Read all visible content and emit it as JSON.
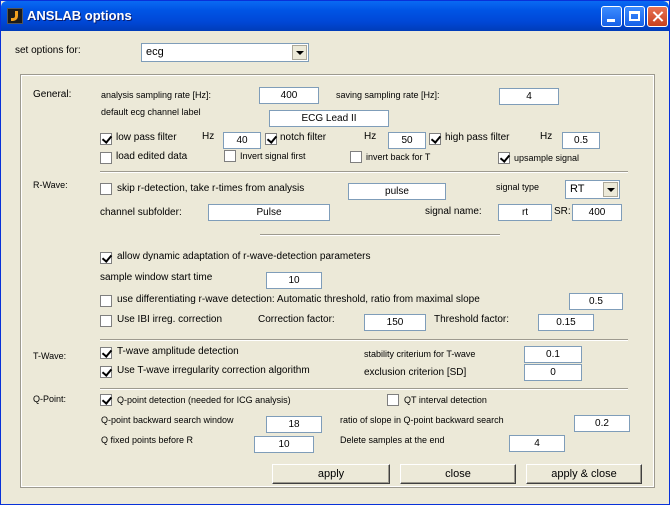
{
  "window": {
    "title": "ANSLAB options"
  },
  "top": {
    "set_options_label": "set options for:",
    "set_options_value": "ecg"
  },
  "general": {
    "section_label": "General:",
    "analysis_rate_label": "analysis sampling rate [Hz]:",
    "analysis_rate_value": "400",
    "saving_rate_label": "saving sampling rate [Hz]:",
    "saving_rate_value": "4",
    "channel_label_label": "default ecg channel label",
    "channel_label_value": "ECG Lead II",
    "low_pass_label": "low pass filter",
    "hz1": "Hz",
    "low_pass_value": "40",
    "notch_label": "notch filter",
    "hz2": "Hz",
    "notch_value": "50",
    "high_pass_label": "high pass filter",
    "hz3": "Hz",
    "high_pass_value": "0.5",
    "load_edited_label": "load edited data",
    "invert_first_label": "Invert signal first",
    "invert_back_label": "invert back for T",
    "upsample_label": "upsample signal"
  },
  "rwave": {
    "section_label": "R-Wave:",
    "skip_label": "skip r-detection, take r-times from analysis",
    "skip_value": "pulse",
    "signal_type_label": "signal type",
    "signal_type_value": "RT",
    "channel_subfolder_label": "channel subfolder:",
    "channel_subfolder_value": "Pulse",
    "signal_name_label": "signal name:",
    "signal_name_value": "rt",
    "sr_label": "SR:",
    "sr_value": "400",
    "dynamic_label": "allow dynamic adaptation of r-wave-detection parameters",
    "sample_window_label": "sample window start time",
    "sample_window_value": "10",
    "differentiating_label": "use differentiating r-wave detection: Automatic threshold, ratio from maximal slope",
    "differentiating_value": "0.5",
    "ibi_label": "Use IBI irreg. correction",
    "correction_factor_label": "Correction factor:",
    "correction_factor_value": "150",
    "threshold_factor_label": "Threshold factor:",
    "threshold_factor_value": "0.15"
  },
  "twave": {
    "section_label": "T-Wave:",
    "amplitude_label": "T-wave amplitude detection",
    "stability_label": "stability criterium for T-wave",
    "stability_value": "0.1",
    "irregularity_label": "Use T-wave irregularity correction algorithm",
    "exclusion_label": "exclusion criterion [SD]",
    "exclusion_value": "0"
  },
  "qpoint": {
    "section_label": "Q-Point:",
    "detection_label": "Q-point detection (needed for ICG analysis)",
    "qt_label": "QT interval detection",
    "backward_window_label": "Q-point backward search  window",
    "backward_window_value": "18",
    "slope_ratio_label": "ratio of slope in Q-point backward search",
    "slope_ratio_value": "0.2",
    "fixed_points_label": "Q fixed points before R",
    "fixed_points_value": "10",
    "delete_samples_label": "Delete samples at the end",
    "delete_samples_value": "4"
  },
  "buttons": {
    "apply": "apply",
    "close": "close",
    "apply_close": "apply & close"
  },
  "checkbox_state": {
    "low_pass": true,
    "notch": true,
    "high_pass": true,
    "load_edited": false,
    "invert_first": false,
    "invert_back": false,
    "upsample": true,
    "skip": false,
    "dynamic": true,
    "differentiating": false,
    "ibi": false,
    "amplitude": true,
    "irregularity": true,
    "qdetection": true,
    "qt": false
  }
}
